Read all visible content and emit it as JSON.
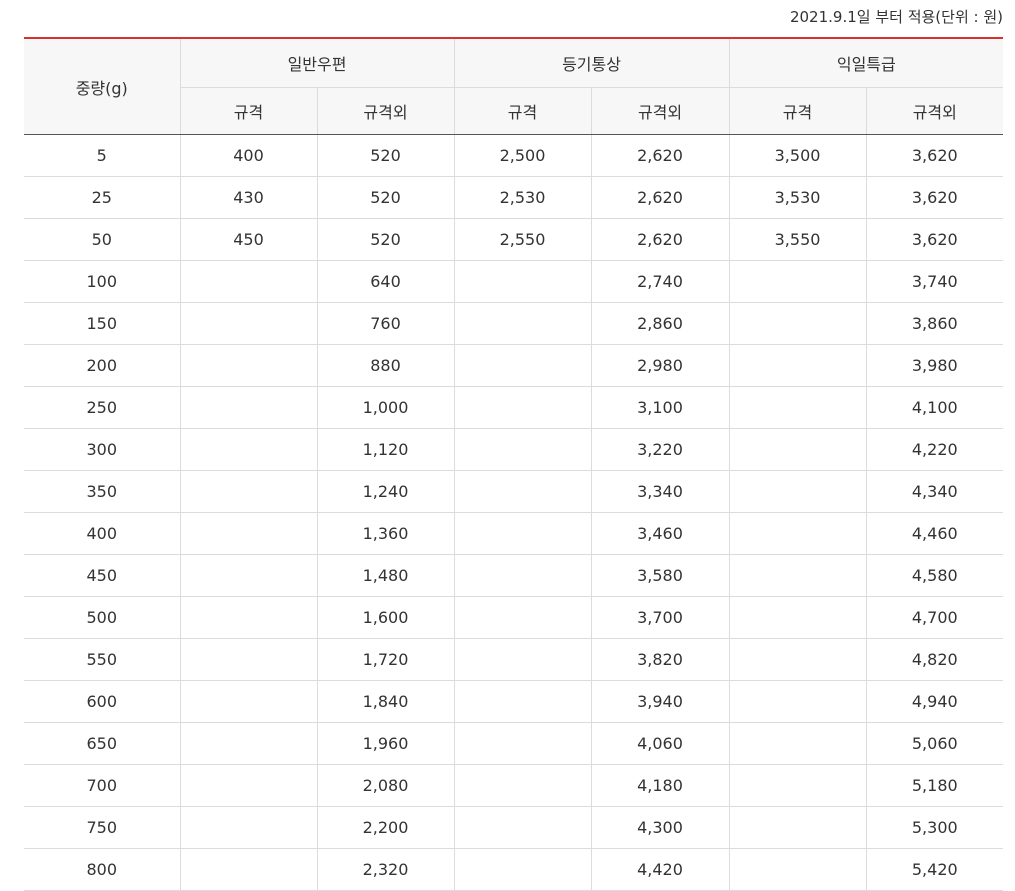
{
  "note": "2021.9.1일 부터 적용(단위 : 원)",
  "headers": {
    "weight": "중량(g)",
    "groups": [
      "일반우편",
      "등기통상",
      "익일특급"
    ],
    "sub": [
      "규격",
      "규격외",
      "규격",
      "규격외",
      "규격",
      "규격외"
    ]
  },
  "rows": [
    [
      "5",
      "400",
      "520",
      "2,500",
      "2,620",
      "3,500",
      "3,620"
    ],
    [
      "25",
      "430",
      "520",
      "2,530",
      "2,620",
      "3,530",
      "3,620"
    ],
    [
      "50",
      "450",
      "520",
      "2,550",
      "2,620",
      "3,550",
      "3,620"
    ],
    [
      "100",
      "",
      "640",
      "",
      "2,740",
      "",
      "3,740"
    ],
    [
      "150",
      "",
      "760",
      "",
      "2,860",
      "",
      "3,860"
    ],
    [
      "200",
      "",
      "880",
      "",
      "2,980",
      "",
      "3,980"
    ],
    [
      "250",
      "",
      "1,000",
      "",
      "3,100",
      "",
      "4,100"
    ],
    [
      "300",
      "",
      "1,120",
      "",
      "3,220",
      "",
      "4,220"
    ],
    [
      "350",
      "",
      "1,240",
      "",
      "3,340",
      "",
      "4,340"
    ],
    [
      "400",
      "",
      "1,360",
      "",
      "3,460",
      "",
      "4,460"
    ],
    [
      "450",
      "",
      "1,480",
      "",
      "3,580",
      "",
      "4,580"
    ],
    [
      "500",
      "",
      "1,600",
      "",
      "3,700",
      "",
      "4,700"
    ],
    [
      "550",
      "",
      "1,720",
      "",
      "3,820",
      "",
      "4,820"
    ],
    [
      "600",
      "",
      "1,840",
      "",
      "3,940",
      "",
      "4,940"
    ],
    [
      "650",
      "",
      "1,960",
      "",
      "4,060",
      "",
      "5,060"
    ],
    [
      "700",
      "",
      "2,080",
      "",
      "4,180",
      "",
      "5,180"
    ],
    [
      "750",
      "",
      "2,200",
      "",
      "4,300",
      "",
      "5,300"
    ],
    [
      "800",
      "",
      "2,320",
      "",
      "4,420",
      "",
      "5,420"
    ]
  ]
}
